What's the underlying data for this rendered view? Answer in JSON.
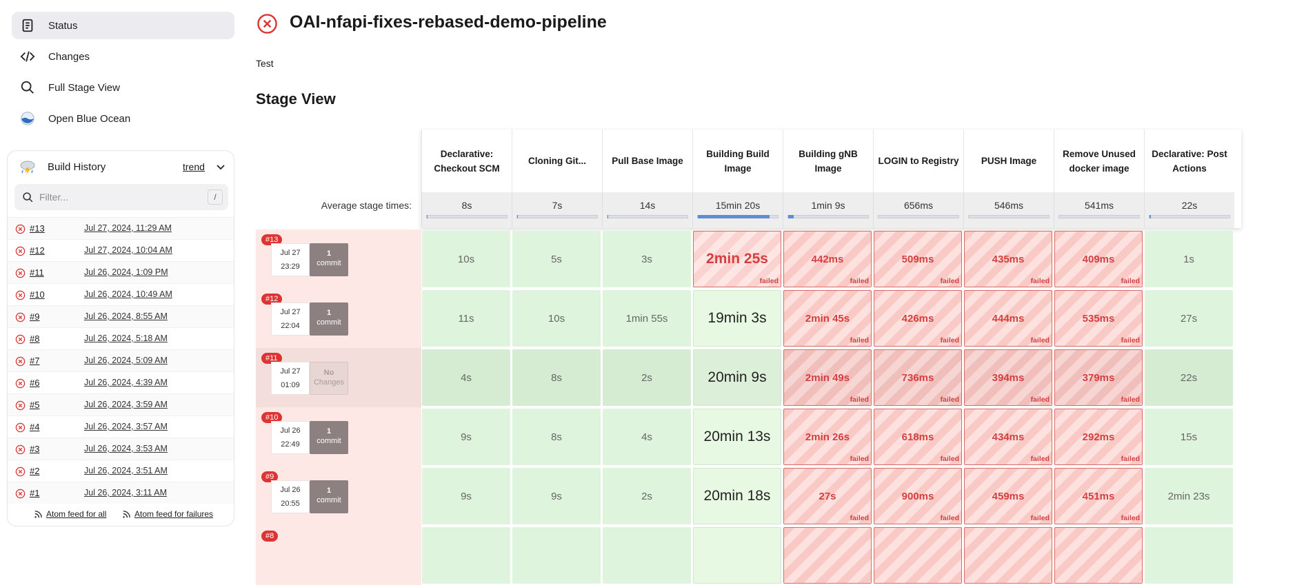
{
  "nav": {
    "status": "Status",
    "changes": "Changes",
    "full_stage_view": "Full Stage View",
    "open_blue_ocean": "Open Blue Ocean"
  },
  "build_history": {
    "title": "Build History",
    "trend": "trend",
    "filter_placeholder": "Filter...",
    "shortcut": "/",
    "builds": [
      {
        "num": "#13",
        "date": "Jul 27, 2024, 11:29 AM"
      },
      {
        "num": "#12",
        "date": "Jul 27, 2024, 10:04 AM"
      },
      {
        "num": "#11",
        "date": "Jul 26, 2024, 1:09 PM"
      },
      {
        "num": "#10",
        "date": "Jul 26, 2024, 10:49 AM"
      },
      {
        "num": "#9",
        "date": "Jul 26, 2024, 8:55 AM"
      },
      {
        "num": "#8",
        "date": "Jul 26, 2024, 5:18 AM"
      },
      {
        "num": "#7",
        "date": "Jul 26, 2024, 5:09 AM"
      },
      {
        "num": "#6",
        "date": "Jul 26, 2024, 4:39 AM"
      },
      {
        "num": "#5",
        "date": "Jul 26, 2024, 3:59 AM"
      },
      {
        "num": "#4",
        "date": "Jul 26, 2024, 3:57 AM"
      },
      {
        "num": "#3",
        "date": "Jul 26, 2024, 3:53 AM"
      },
      {
        "num": "#2",
        "date": "Jul 26, 2024, 3:51 AM"
      },
      {
        "num": "#1",
        "date": "Jul 26, 2024, 3:11 AM"
      }
    ],
    "feed_all": "Atom feed for all",
    "feed_failures": "Atom feed for failures"
  },
  "page": {
    "title": "OAI-nfapi-fixes-rebased-demo-pipeline",
    "description": "Test",
    "stage_view_title": "Stage View",
    "avg_label": "Average stage times:"
  },
  "stages": [
    {
      "name": "Declarative: Checkout SCM",
      "avg": "8s",
      "avg_fill": 0.01
    },
    {
      "name": "Cloning Git...",
      "avg": "7s",
      "avg_fill": 0.01
    },
    {
      "name": "Pull Base Image",
      "avg": "14s",
      "avg_fill": 0.01
    },
    {
      "name": "Building Build Image",
      "avg": "15min 20s",
      "avg_fill": 0.9
    },
    {
      "name": "Building gNB Image",
      "avg": "1min 9s",
      "avg_fill": 0.07
    },
    {
      "name": "LOGIN to Registry",
      "avg": "656ms",
      "avg_fill": 0.0
    },
    {
      "name": "PUSH Image",
      "avg": "546ms",
      "avg_fill": 0.0
    },
    {
      "name": "Remove Unused docker image",
      "avg": "541ms",
      "avg_fill": 0.0
    },
    {
      "name": "Declarative: Post Actions",
      "avg": "22s",
      "avg_fill": 0.02
    }
  ],
  "failed_label": "failed",
  "runs": [
    {
      "badge": "#13",
      "date": "Jul 27",
      "time": "23:29",
      "commit_count": "1",
      "commit_word": "commit",
      "no_changes": false,
      "cells": [
        {
          "v": "10s",
          "s": "ok"
        },
        {
          "v": "5s",
          "s": "ok"
        },
        {
          "v": "3s",
          "s": "ok"
        },
        {
          "v": "2min 25s",
          "s": "failbig"
        },
        {
          "v": "442ms",
          "s": "fail"
        },
        {
          "v": "509ms",
          "s": "fail"
        },
        {
          "v": "435ms",
          "s": "fail"
        },
        {
          "v": "409ms",
          "s": "fail"
        },
        {
          "v": "1s",
          "s": "ok"
        }
      ]
    },
    {
      "badge": "#12",
      "date": "Jul 27",
      "time": "22:04",
      "commit_count": "1",
      "commit_word": "commit",
      "no_changes": false,
      "cells": [
        {
          "v": "11s",
          "s": "ok"
        },
        {
          "v": "10s",
          "s": "ok"
        },
        {
          "v": "1min 55s",
          "s": "ok"
        },
        {
          "v": "19min 3s",
          "s": "okbig"
        },
        {
          "v": "2min 45s",
          "s": "fail"
        },
        {
          "v": "426ms",
          "s": "fail"
        },
        {
          "v": "444ms",
          "s": "fail"
        },
        {
          "v": "535ms",
          "s": "fail"
        },
        {
          "v": "27s",
          "s": "ok"
        }
      ]
    },
    {
      "badge": "#11",
      "date": "Jul 27",
      "time": "01:09",
      "commit_count": "No",
      "commit_word": "Changes",
      "no_changes": true,
      "cells": [
        {
          "v": "4s",
          "s": "ok"
        },
        {
          "v": "8s",
          "s": "ok"
        },
        {
          "v": "2s",
          "s": "ok"
        },
        {
          "v": "20min 9s",
          "s": "okbig"
        },
        {
          "v": "2min 49s",
          "s": "fail"
        },
        {
          "v": "736ms",
          "s": "fail"
        },
        {
          "v": "394ms",
          "s": "fail"
        },
        {
          "v": "379ms",
          "s": "fail"
        },
        {
          "v": "22s",
          "s": "ok"
        }
      ]
    },
    {
      "badge": "#10",
      "date": "Jul 26",
      "time": "22:49",
      "commit_count": "1",
      "commit_word": "commit",
      "no_changes": false,
      "cells": [
        {
          "v": "9s",
          "s": "ok"
        },
        {
          "v": "8s",
          "s": "ok"
        },
        {
          "v": "4s",
          "s": "ok"
        },
        {
          "v": "20min 13s",
          "s": "okbig"
        },
        {
          "v": "2min 26s",
          "s": "fail"
        },
        {
          "v": "618ms",
          "s": "fail"
        },
        {
          "v": "434ms",
          "s": "fail"
        },
        {
          "v": "292ms",
          "s": "fail"
        },
        {
          "v": "15s",
          "s": "ok"
        }
      ]
    },
    {
      "badge": "#9",
      "date": "Jul 26",
      "time": "20:55",
      "commit_count": "1",
      "commit_word": "commit",
      "no_changes": false,
      "cells": [
        {
          "v": "9s",
          "s": "ok"
        },
        {
          "v": "9s",
          "s": "ok"
        },
        {
          "v": "2s",
          "s": "ok"
        },
        {
          "v": "20min 18s",
          "s": "okbig"
        },
        {
          "v": "27s",
          "s": "fail"
        },
        {
          "v": "900ms",
          "s": "fail"
        },
        {
          "v": "459ms",
          "s": "fail"
        },
        {
          "v": "451ms",
          "s": "fail"
        },
        {
          "v": "2min 23s",
          "s": "ok"
        }
      ]
    },
    {
      "badge": "#8",
      "date": "",
      "time": "",
      "commit_count": "",
      "commit_word": "",
      "no_changes": false,
      "cells": [
        {
          "v": "",
          "s": "ok"
        },
        {
          "v": "",
          "s": "ok"
        },
        {
          "v": "",
          "s": "ok"
        },
        {
          "v": "",
          "s": "okbig"
        },
        {
          "v": "",
          "s": "fail"
        },
        {
          "v": "",
          "s": "fail"
        },
        {
          "v": "",
          "s": "fail"
        },
        {
          "v": "",
          "s": "fail"
        },
        {
          "v": "",
          "s": "ok"
        }
      ]
    }
  ],
  "colors": {
    "failure": "#d33333",
    "success_cell": "#dff4dc",
    "fail_border": "#d96a6a",
    "avg_bar": "#5a8fd6"
  }
}
